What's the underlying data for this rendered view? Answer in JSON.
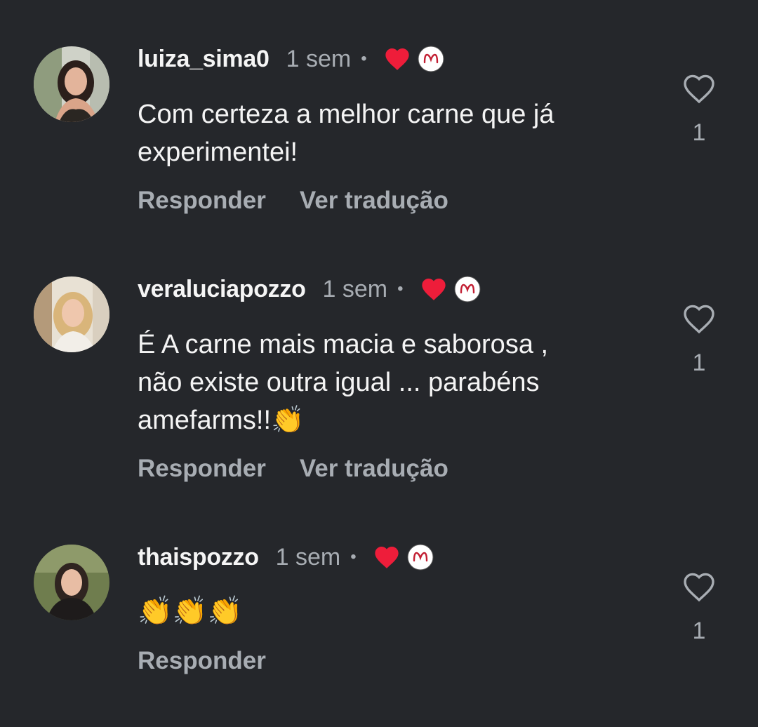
{
  "comments": [
    {
      "username": "luiza_sima0",
      "time": "1 sem",
      "separator": "•",
      "text_lines": [
        "Com certeza a melhor carne que já",
        "experimentei!"
      ],
      "actions": [
        "Responder",
        "Ver tradução"
      ],
      "likes": "1",
      "liked_by_author": true
    },
    {
      "username": "veraluciapozzo",
      "time": "1 sem",
      "separator": "•",
      "text_lines": [
        "É A carne mais macia e saborosa ,",
        "não existe outra igual ... parabéns",
        "amefarms!!👏"
      ],
      "actions": [
        "Responder",
        "Ver tradução"
      ],
      "likes": "1",
      "liked_by_author": true
    },
    {
      "username": "thaispozzo",
      "time": "1 sem",
      "separator": "•",
      "text_lines": [
        "👏👏👏"
      ],
      "actions": [
        "Responder"
      ],
      "likes": "1",
      "liked_by_author": true
    }
  ],
  "colors": {
    "background": "#25272b",
    "primary_text": "#f4f4f4",
    "secondary_text": "#a8adb3",
    "heart_red": "#ee1d3a"
  },
  "icons": [
    "creator-heart-icon",
    "author-avatar-icon",
    "like-heart-outline-icon"
  ]
}
